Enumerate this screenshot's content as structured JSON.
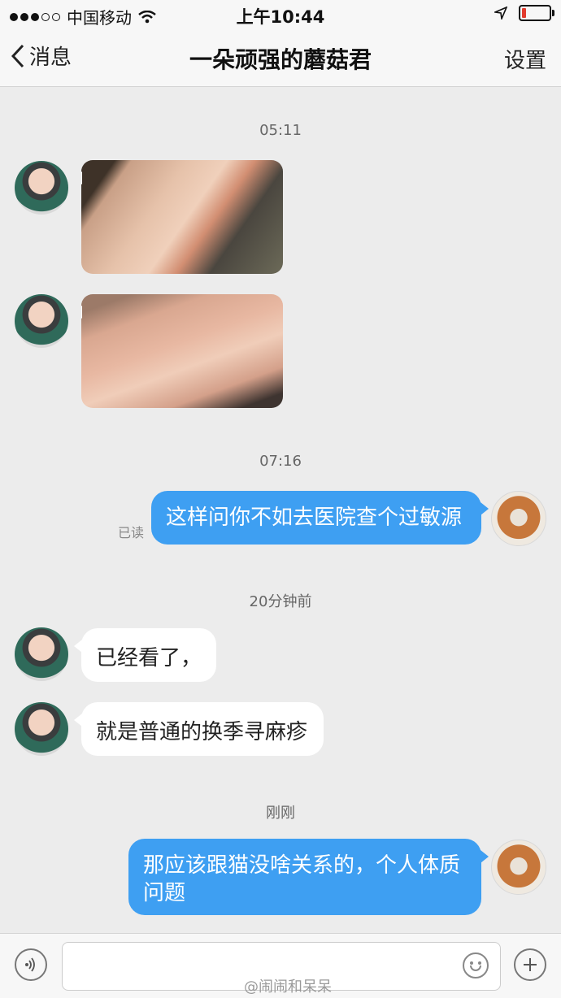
{
  "status_bar": {
    "carrier": "中国移动",
    "time": "上午10:44",
    "signal_icon": "signal-dots-icon",
    "wifi_icon": "wifi-icon",
    "location_icon": "location-arrow-icon",
    "battery_icon": "battery-icon",
    "battery_level": 0.15,
    "battery_color": "#e23b2e"
  },
  "nav": {
    "back_label": "消息",
    "title": "一朵顽强的蘑菇君",
    "settings_label": "设置"
  },
  "messages": {
    "ts1": "05:11",
    "ts2": "07:16",
    "read_label": "已读",
    "out1": "这样问你不如去医院查个过敏源",
    "ts3": "20分钟前",
    "in1": "已经看了，",
    "in2": "就是普通的换季寻麻疹",
    "ts4": "刚刚",
    "out2": "那应该跟猫没啥关系的，个人体质问题"
  },
  "input_bar": {
    "voice_icon": "voice-icon",
    "emoji_icon": "emoji-icon",
    "plus_icon": "plus-icon"
  },
  "watermark": "@闹闹和呆呆",
  "colors": {
    "outgoing_bubble": "#3e9ff2",
    "incoming_bubble": "#ffffff",
    "background": "#ececec"
  }
}
